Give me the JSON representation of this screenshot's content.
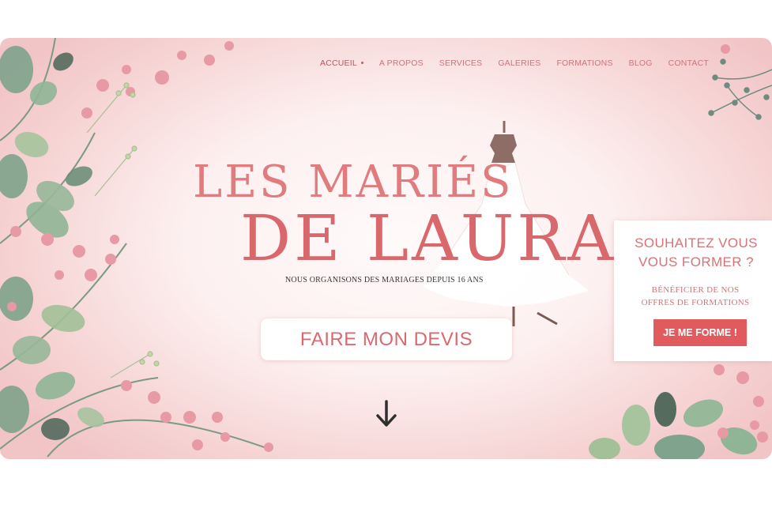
{
  "nav": {
    "items": [
      {
        "label": "ACCUEIL",
        "active": true
      },
      {
        "label": "A PROPOS"
      },
      {
        "label": "SERVICES"
      },
      {
        "label": "GALERIES"
      },
      {
        "label": "FORMATIONS"
      },
      {
        "label": "BLOG"
      },
      {
        "label": "CONTACT"
      }
    ]
  },
  "hero": {
    "title_line1": "LES MARIÉS",
    "title_line2": "DE LAURA",
    "subtitle": "NOUS ORGANISONS DES MARIAGES DEPUIS 16 ANS",
    "cta_label": "FAIRE MON DEVIS",
    "scroll_icon": "arrow-down-icon"
  },
  "promo": {
    "heading_line1": "SOUHAITEZ VOUS",
    "heading_line2": "VOUS FORMER ?",
    "text_line1": "BÉNÉFICIER DE NOS",
    "text_line2": "OFFRES DE FORMATIONS",
    "button_label": "JE ME FORME !"
  },
  "colors": {
    "accent": "#e05a5e",
    "title": "#e07b7e",
    "background_pink": "#f6d3d3",
    "leaf_green": "#8fb596"
  }
}
